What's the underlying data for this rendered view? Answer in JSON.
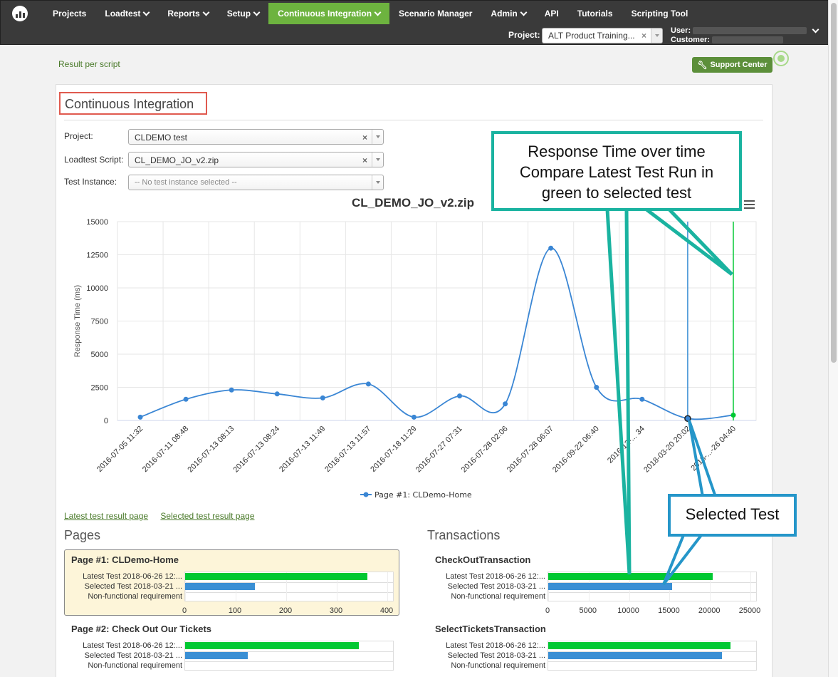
{
  "nav": {
    "items": [
      "Projects",
      "Loadtest",
      "Reports",
      "Setup",
      "Continuous Integration",
      "Scenario Manager",
      "Admin",
      "API",
      "Tutorials",
      "Scripting Tool"
    ],
    "project_label": "Project:",
    "project_value": "ALT Product Training...",
    "user_label": "User:",
    "customer_label": "Customer:"
  },
  "header": {
    "result_link": "Result per script",
    "support_button": "Support Center"
  },
  "page": {
    "title": "Continuous Integration",
    "project_label": "Project:",
    "project_value": "CLDEMO test",
    "script_label": "Loadtest Script:",
    "script_value": "CL_DEMO_JO_v2.zip",
    "instance_label": "Test Instance:",
    "instance_placeholder": "-- No test instance selected --",
    "latest_link": "Latest test result page",
    "selected_link": "Selected test result page",
    "pages_title": "Pages",
    "transactions_title": "Transactions"
  },
  "chart_data": {
    "type": "line",
    "title": "CL_DEMO_JO_v2.zip",
    "ylabel": "Response Time (ms)",
    "ylim": [
      0,
      15000
    ],
    "yticks": [
      0,
      2500,
      5000,
      7500,
      10000,
      12500,
      15000
    ],
    "categories": [
      "2016-07-05 11:32",
      "2016-07-11 08:48",
      "2016-07-13 08:13",
      "2016-07-13 08:24",
      "2016-07-13 11:49",
      "2016-07-13 11:57",
      "2016-07-18 11:29",
      "2016-07-27 07:31",
      "2016-07-28 02:06",
      "2016-07-28 06:07",
      "2016-09-22 06:40",
      "2016-12-... 34",
      "2018-03-20 20:02",
      "2018-...-26 04:40"
    ],
    "series": [
      {
        "name": "Page #1: CLDemo-Home",
        "color": "#3a86d4",
        "values": [
          250,
          1600,
          2300,
          2000,
          1700,
          2750,
          250,
          1850,
          1250,
          13000,
          2500,
          1600,
          150,
          400
        ]
      }
    ],
    "selected_index": 12,
    "latest_index": 13,
    "grid": true,
    "legend": "bottom-center"
  },
  "bar_cards": [
    {
      "title": "Page #1: CLDemo-Home",
      "rows": [
        "Latest Test 2018-06-26 12:...",
        "Selected Test 2018-03-21 ...",
        "Non-functional requirement"
      ],
      "latest": 360,
      "selected": 138,
      "ticks": [
        "0",
        "100",
        "200",
        "300",
        "400"
      ],
      "max": 400
    },
    {
      "title": "CheckOutTransaction",
      "rows": [
        "Latest Test 2018-06-26 12:...",
        "Selected Test 2018-03-21 ...",
        "Non-functional requirement"
      ],
      "latest": 20300,
      "selected": 15300,
      "ticks": [
        "0",
        "5000",
        "10000",
        "15000",
        "20000",
        "25000"
      ],
      "max": 25000
    },
    {
      "title": "Page #2: Check Out Our Tickets",
      "rows": [
        "Latest Test 2018-06-26 12:...",
        "Selected Test 2018-03-21 ...",
        "Non-functional requirement"
      ],
      "latest": 0.83,
      "selected": 0.3
    },
    {
      "title": "SelectTicketsTransaction",
      "rows": [
        "Latest Test 2018-06-26 12:...",
        "Selected Test 2018-03-21 ...",
        "Non-functional requirement"
      ],
      "latest": 0.87,
      "selected": 0.83
    }
  ],
  "callouts": {
    "green_line1": "Response Time over time",
    "green_line2": "Compare Latest Test Run in",
    "green_line3": "green to selected test",
    "blue": "Selected Test"
  },
  "colors": {
    "latest": "#00c832",
    "selected": "#3a8fd4",
    "nav_active": "#6db33f",
    "callout_green": "#1ab3a0",
    "callout_blue": "#2596c9",
    "title_border": "#e05a4f"
  }
}
